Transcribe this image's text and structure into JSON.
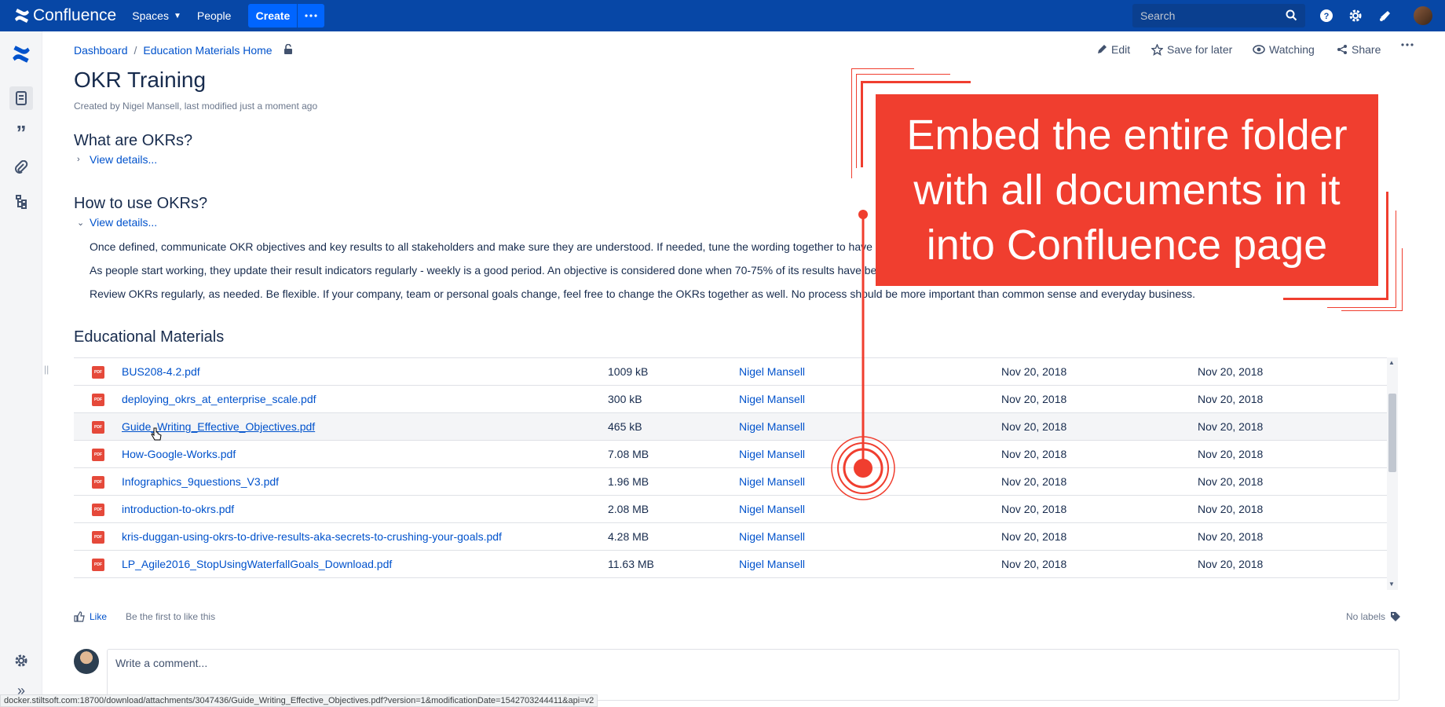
{
  "topnav": {
    "logo_text": "Confluence",
    "spaces_label": "Spaces",
    "people_label": "People",
    "create_label": "Create",
    "search_placeholder": "Search"
  },
  "breadcrumb": {
    "items": [
      "Dashboard",
      "Education Materials Home"
    ]
  },
  "page_actions": {
    "edit": "Edit",
    "save_for_later": "Save for later",
    "watching": "Watching",
    "share": "Share"
  },
  "page": {
    "title": "OKR Training",
    "byline": "Created by Nigel Mansell, last modified just a moment ago"
  },
  "sections": [
    {
      "heading": "What are OKRs?",
      "expand_label": "View details..."
    },
    {
      "heading": "How to use OKRs?",
      "expand_label": "View details...",
      "paragraphs": [
        "Once defined, communicate OKR objectives and key results to all stakeholders and make sure they are understood. If needed, tune the wording together to have a",
        "As people start working, they update their result indicators regularly - weekly is a good period. An objective is considered done when 70-75% of its results have be",
        "Review OKRs regularly, as needed. Be flexible. If your company, team or personal goals change, feel free to change the OKRs together as well. No process should be more important than common sense and everyday business."
      ]
    }
  ],
  "materials": {
    "heading": "Educational Materials",
    "pdf_badge": "PDF",
    "rows": [
      {
        "name": "BUS208-4.2.pdf",
        "size": "1009 kB",
        "creator": "Nigel Mansell",
        "created": "Nov 20, 2018",
        "modified": "Nov 20, 2018"
      },
      {
        "name": "deploying_okrs_at_enterprise_scale.pdf",
        "size": "300 kB",
        "creator": "Nigel Mansell",
        "created": "Nov 20, 2018",
        "modified": "Nov 20, 2018"
      },
      {
        "name": "Guide_Writing_Effective_Objectives.pdf",
        "size": "465 kB",
        "creator": "Nigel Mansell",
        "created": "Nov 20, 2018",
        "modified": "Nov 20, 2018"
      },
      {
        "name": "How-Google-Works.pdf",
        "size": "7.08 MB",
        "creator": "Nigel Mansell",
        "created": "Nov 20, 2018",
        "modified": "Nov 20, 2018"
      },
      {
        "name": "Infographics_9questions_V3.pdf",
        "size": "1.96 MB",
        "creator": "Nigel Mansell",
        "created": "Nov 20, 2018",
        "modified": "Nov 20, 2018"
      },
      {
        "name": "introduction-to-okrs.pdf",
        "size": "2.08 MB",
        "creator": "Nigel Mansell",
        "created": "Nov 20, 2018",
        "modified": "Nov 20, 2018"
      },
      {
        "name": "kris-duggan-using-okrs-to-drive-results-aka-secrets-to-crushing-your-goals.pdf",
        "size": "4.28 MB",
        "creator": "Nigel Mansell",
        "created": "Nov 20, 2018",
        "modified": "Nov 20, 2018"
      },
      {
        "name": "LP_Agile2016_StopUsingWaterfallGoals_Download.pdf",
        "size": "11.63 MB",
        "creator": "Nigel Mansell",
        "created": "Nov 20, 2018",
        "modified": "Nov 20, 2018"
      }
    ]
  },
  "footer": {
    "like_label": "Like",
    "like_prompt": "Be the first to like this",
    "labels_text": "No labels",
    "comment_placeholder": "Write a comment..."
  },
  "statusbar_url": "docker.stiltsoft.com:18700/download/attachments/3047436/Guide_Writing_Effective_Objectives.pdf?version=1&modificationDate=1542703244411&api=v2",
  "callout": {
    "lines": [
      "Embed the entire folder",
      "with all documents in it",
      "into Confluence page"
    ],
    "color": "#f03e2f"
  }
}
